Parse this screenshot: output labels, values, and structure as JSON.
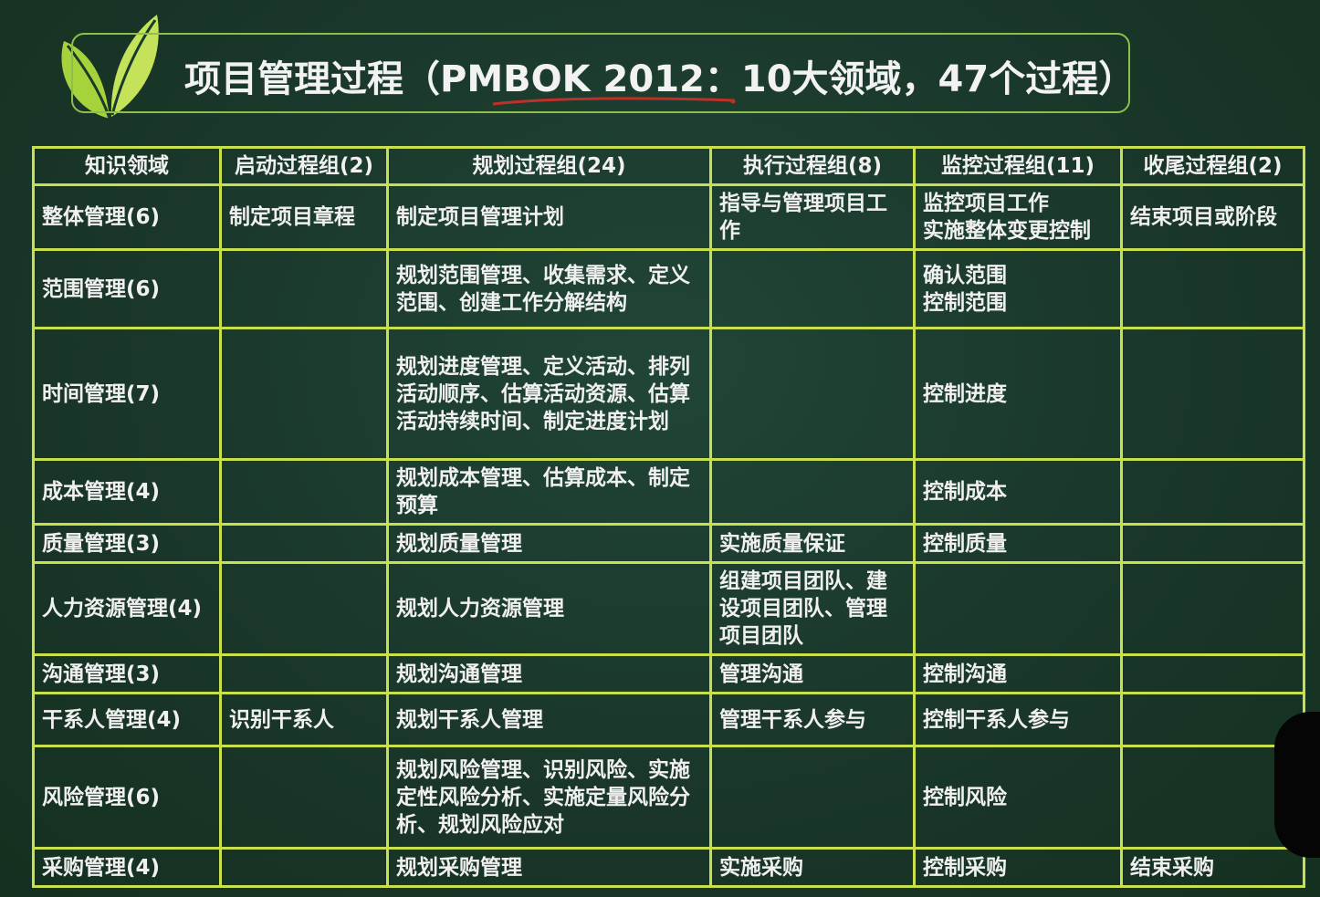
{
  "title": "项目管理过程（PMBOK 2012：10大领域，47个过程）",
  "colors": {
    "background": "#1b3a2f",
    "grid_line": "#c8e04c",
    "title_border": "#8fbf4a",
    "leaf_green": "#a6d33b",
    "underline_red": "#c0302a"
  },
  "table": {
    "headers": [
      "知识领域",
      "启动过程组(2)",
      "规划过程组(24)",
      "执行过程组(8)",
      "监控过程组(11)",
      "收尾过程组(2)"
    ],
    "rows": [
      {
        "area": "整体管理(6)",
        "initiating": "制定项目章程",
        "planning": "制定项目管理计划",
        "executing": "指导与管理项目工作",
        "monitoring": "监控项目工作\n实施整体变更控制",
        "closing": "结束项目或阶段"
      },
      {
        "area": "范围管理(6)",
        "initiating": "",
        "planning": "规划范围管理、收集需求、定义范围、创建工作分解结构",
        "executing": "",
        "monitoring": "确认范围\n控制范围",
        "closing": ""
      },
      {
        "area": "时间管理(7)",
        "initiating": "",
        "planning": "规划进度管理、定义活动、排列活动顺序、估算活动资源、估算活动持续时间、制定进度计划",
        "executing": "",
        "monitoring": "控制进度",
        "closing": ""
      },
      {
        "area": "成本管理(4)",
        "initiating": "",
        "planning": "规划成本管理、估算成本、制定预算",
        "executing": "",
        "monitoring": "控制成本",
        "closing": ""
      },
      {
        "area": "质量管理(3)",
        "initiating": "",
        "planning": "规划质量管理",
        "executing": "实施质量保证",
        "monitoring": "控制质量",
        "closing": ""
      },
      {
        "area": "人力资源管理(4)",
        "initiating": "",
        "planning": "规划人力资源管理",
        "executing": "组建项目团队、建设项目团队、管理项目团队",
        "monitoring": "",
        "closing": ""
      },
      {
        "area": "沟通管理(3)",
        "initiating": "",
        "planning": "规划沟通管理",
        "executing": "管理沟通",
        "monitoring": "控制沟通",
        "closing": ""
      },
      {
        "area": "干系人管理(4)",
        "initiating": "识别干系人",
        "planning": "规划干系人管理",
        "executing": "管理干系人参与",
        "monitoring": "控制干系人参与",
        "closing": ""
      },
      {
        "area": "风险管理(6)",
        "initiating": "",
        "planning": "规划风险管理、识别风险、实施定性风险分析、实施定量风险分析、规划风险应对",
        "executing": "",
        "monitoring": "控制风险",
        "closing": ""
      },
      {
        "area": "采购管理(4)",
        "initiating": "",
        "planning": "规划采购管理",
        "executing": "实施采购",
        "monitoring": "控制采购",
        "closing": "结束采购"
      }
    ]
  }
}
